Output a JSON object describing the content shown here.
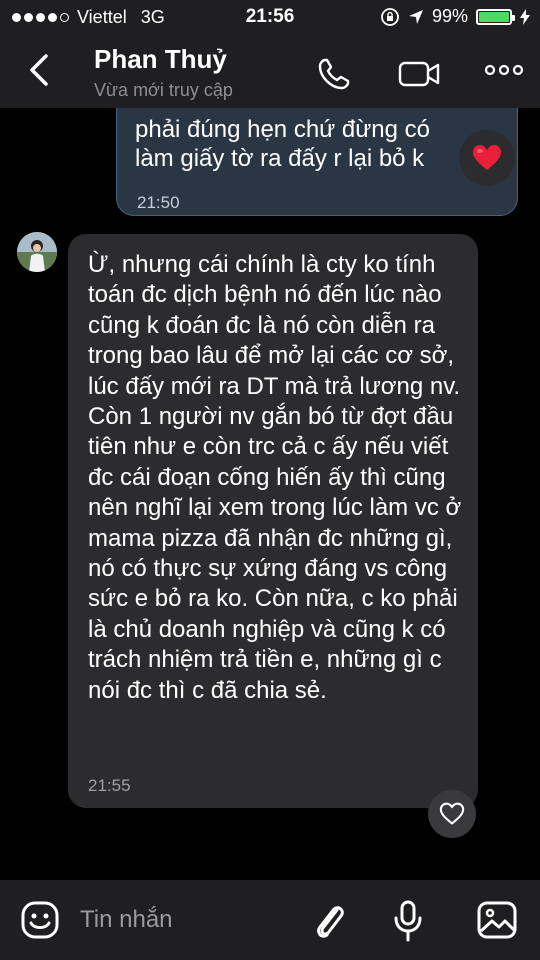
{
  "status_bar": {
    "carrier": "Viettel",
    "network": "3G",
    "time": "21:56",
    "battery_percent": "99%",
    "battery_level": 0.99,
    "battery_color": "#4cd964"
  },
  "header": {
    "contact_name": "Phan Thuỷ",
    "contact_status": "Vừa mới truy cập",
    "icons": [
      "back-chevron-icon",
      "phone-icon",
      "video-camera-icon",
      "more-options-icon"
    ]
  },
  "messages": {
    "outgoing": {
      "text": "phải đúng hẹn chứ đừng có làm giấy tờ ra đấy r lại bỏ k",
      "time": "21:50",
      "reaction": "❤️"
    },
    "incoming": {
      "text": "Ừ, nhưng cái chính là cty ko tính toán đc dịch bệnh nó đến lúc nào cũng k đoán đc là nó còn diễn ra trong bao lâu để mở lại các cơ sở, lúc đấy mới ra DT mà trả lương nv. Còn 1 người nv gắn bó từ đợt đầu tiên như e còn trc cả c ấy nếu viết đc cái đoạn cống hiến ấy thì cũng nên nghĩ lại xem trong lúc làm vc ở mama pizza đã nhận đc những gì, nó có thực sự xứng đáng vs công sức e bỏ ra ko. Còn nữa, c ko phải là chủ doanh nghiệp và cũng k có trách nhiệm trả tiền e, những gì c nói đc thì c đã chia sẻ.",
      "time": "21:55"
    }
  },
  "input_bar": {
    "placeholder": "Tin nhắn",
    "icons": [
      "emoji-icon",
      "attachment-icon",
      "microphone-icon",
      "image-icon"
    ]
  },
  "colors": {
    "outgoing_bubble": "#2b3645",
    "outgoing_border": "#4a6081",
    "incoming_bubble": "#2c2c2e",
    "bar_background": "#1f1f21"
  }
}
